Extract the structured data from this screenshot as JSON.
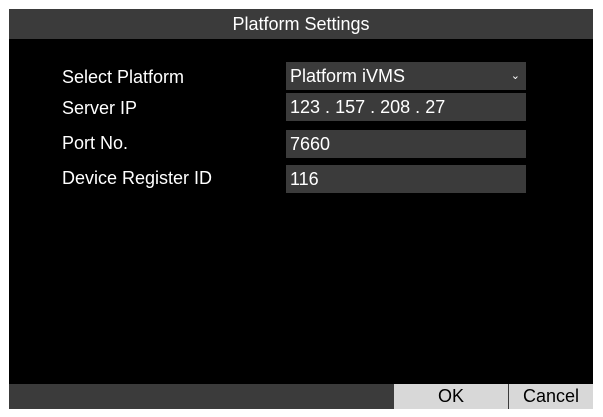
{
  "dialog": {
    "title": "Platform Settings"
  },
  "form": {
    "select_platform": {
      "label": "Select Platform",
      "value": "Platform iVMS",
      "arrow_icon": "chevron-down-icon"
    },
    "server_ip": {
      "label": "Server IP",
      "octets": [
        "123",
        "157",
        "208",
        "27"
      ],
      "separator": "."
    },
    "port": {
      "label": "Port No.",
      "value": "7660"
    },
    "device_register_id": {
      "label": "Device Register ID",
      "value": "116"
    }
  },
  "buttons": {
    "ok": "OK",
    "cancel": "Cancel"
  },
  "colors": {
    "background": "#000000",
    "bar": "#3b3b3b",
    "button": "#d8d8d8",
    "text": "#ffffff"
  }
}
